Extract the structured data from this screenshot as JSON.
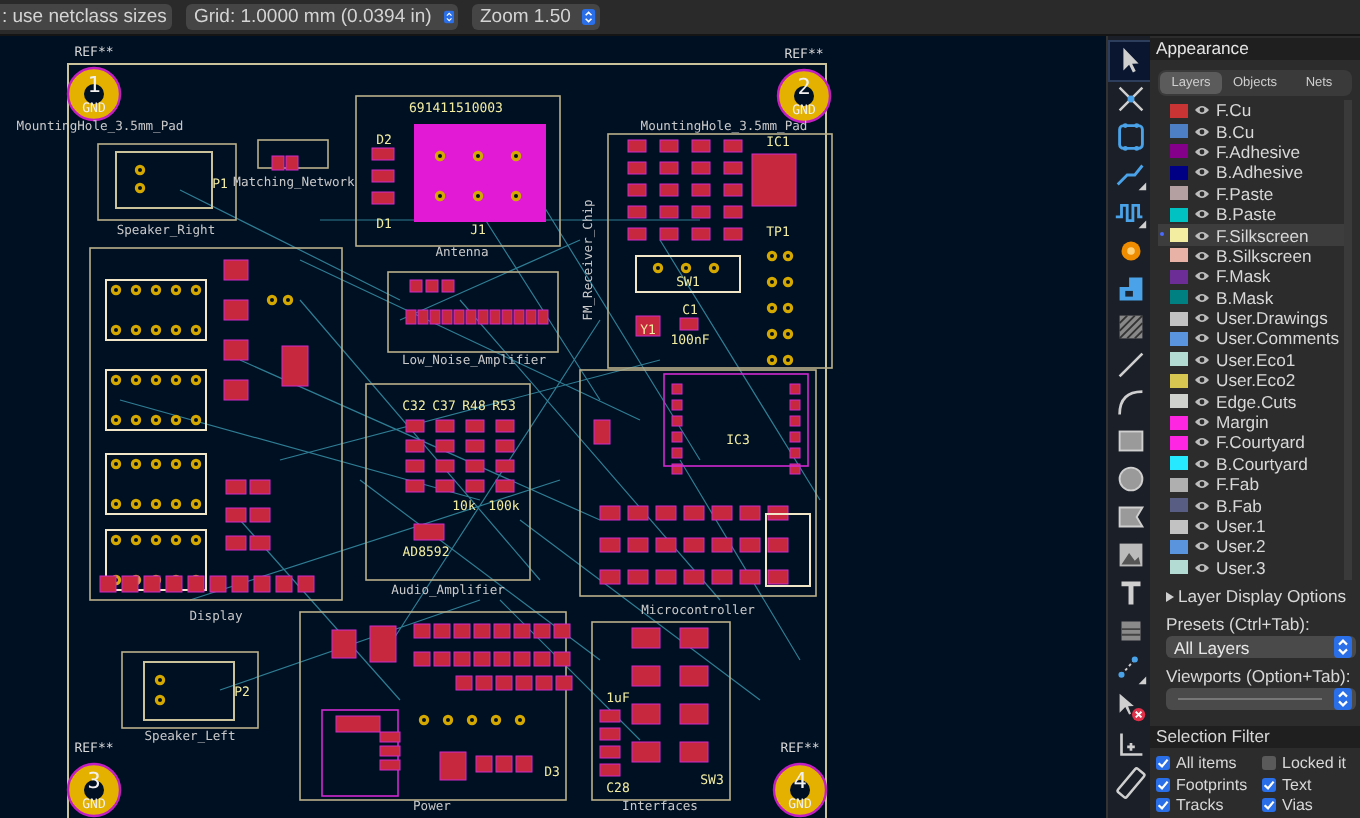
{
  "toolbar": {
    "track_select": ": use netclass sizes",
    "grid_select": "Grid: 1.0000 mm (0.0394 in)",
    "zoom_select": "Zoom 1.50"
  },
  "board": {
    "mounting_holes": [
      {
        "ref": "REF**",
        "number": "1",
        "net": "GND",
        "footprint": "MountingHole_3.5mm_Pad"
      },
      {
        "ref": "REF**",
        "number": "2",
        "net": "GND",
        "footprint": "MountingHole_3.5mm_Pad"
      },
      {
        "ref": "REF**",
        "number": "3",
        "net": "GND"
      },
      {
        "ref": "REF**",
        "number": "4",
        "net": "GND"
      }
    ],
    "groups": [
      {
        "name": "Speaker_Right"
      },
      {
        "name": "Matching_Network"
      },
      {
        "name": "Antenna"
      },
      {
        "name": "Low_Noise_Amplifier"
      },
      {
        "name": "FM_Receiver_Chip"
      },
      {
        "name": "Display"
      },
      {
        "name": "Audio_Amplifier"
      },
      {
        "name": "Microcontroller"
      },
      {
        "name": "Speaker_Left"
      },
      {
        "name": "Power"
      },
      {
        "name": "Interfaces"
      }
    ],
    "component_labels": [
      "691411510003",
      "J1",
      "D2",
      "D1",
      "P1",
      "SW1",
      "IC1",
      "C1",
      "100nF",
      "TP1",
      "IC3",
      "AD8592",
      "10k",
      "100k",
      "C32",
      "C37",
      "R48",
      "R53",
      "P2",
      "SW3",
      "1uF",
      "C28",
      "D3",
      "Y1"
    ]
  },
  "tools": [
    {
      "kind": "select",
      "selected": true
    },
    {
      "kind": "ratsnest",
      "selected": false
    },
    {
      "kind": "footprint",
      "selected": false
    },
    {
      "kind": "route",
      "selected": false
    },
    {
      "kind": "tune",
      "selected": false
    },
    {
      "kind": "via",
      "selected": false
    },
    {
      "kind": "zone",
      "selected": false
    },
    {
      "kind": "rule-area",
      "selected": false
    },
    {
      "kind": "line",
      "selected": false
    },
    {
      "kind": "arc",
      "selected": false
    },
    {
      "kind": "rect",
      "selected": false
    },
    {
      "kind": "circle",
      "selected": false
    },
    {
      "kind": "polygon",
      "selected": false
    },
    {
      "kind": "image",
      "selected": false
    },
    {
      "kind": "text",
      "selected": false
    },
    {
      "kind": "table",
      "selected": false
    },
    {
      "kind": "points",
      "selected": false
    },
    {
      "kind": "delete",
      "selected": false
    },
    {
      "kind": "origin",
      "selected": false
    },
    {
      "kind": "measure",
      "selected": false
    }
  ],
  "appearance": {
    "title": "Appearance",
    "tabs": [
      {
        "label": "Layers",
        "selected": true
      },
      {
        "label": "Objects",
        "selected": false
      },
      {
        "label": "Nets",
        "selected": false
      }
    ],
    "layers": [
      {
        "name": "F.Cu",
        "color": "#c83434",
        "visible": true,
        "selected": false
      },
      {
        "name": "B.Cu",
        "color": "#4d7fc4",
        "visible": true,
        "selected": false
      },
      {
        "name": "F.Adhesive",
        "color": "#84008a",
        "visible": true,
        "selected": false
      },
      {
        "name": "B.Adhesive",
        "color": "#000084",
        "visible": true,
        "selected": false
      },
      {
        "name": "F.Paste",
        "color": "#b4a0a0",
        "visible": true,
        "selected": false
      },
      {
        "name": "B.Paste",
        "color": "#00c2c2",
        "visible": true,
        "selected": false
      },
      {
        "name": "F.Silkscreen",
        "color": "#f2eda1",
        "visible": true,
        "selected": true
      },
      {
        "name": "B.Silkscreen",
        "color": "#e8b2a7",
        "visible": true,
        "selected": false
      },
      {
        "name": "F.Mask",
        "color": "#6c2d96",
        "visible": true,
        "selected": false
      },
      {
        "name": "B.Mask",
        "color": "#008080",
        "visible": true,
        "selected": false
      },
      {
        "name": "User.Drawings",
        "color": "#c2c2c2",
        "visible": true,
        "selected": false
      },
      {
        "name": "User.Comments",
        "color": "#5994dc",
        "visible": true,
        "selected": false
      },
      {
        "name": "User.Eco1",
        "color": "#b4dbd2",
        "visible": true,
        "selected": false
      },
      {
        "name": "User.Eco2",
        "color": "#d8c852",
        "visible": true,
        "selected": false
      },
      {
        "name": "Edge.Cuts",
        "color": "#d0d2cd",
        "visible": true,
        "selected": false
      },
      {
        "name": "Margin",
        "color": "#ff26e2",
        "visible": true,
        "selected": false
      },
      {
        "name": "F.Courtyard",
        "color": "#ff26e3",
        "visible": true,
        "selected": false
      },
      {
        "name": "B.Courtyard",
        "color": "#26e9ff",
        "visible": true,
        "selected": false
      },
      {
        "name": "F.Fab",
        "color": "#afafaf",
        "visible": true,
        "selected": false
      },
      {
        "name": "B.Fab",
        "color": "#585d84",
        "visible": true,
        "selected": false
      },
      {
        "name": "User.1",
        "color": "#c2c2c3",
        "visible": true,
        "selected": false
      },
      {
        "name": "User.2",
        "color": "#5994dd",
        "visible": true,
        "selected": false
      },
      {
        "name": "User.3",
        "color": "#b4dbd3",
        "visible": true,
        "selected": false
      }
    ],
    "layer_display_options": "Layer Display Options",
    "presets": {
      "label": "Presets (Ctrl+Tab):",
      "value": "All Layers"
    },
    "viewports": {
      "label": "Viewports (Option+Tab):"
    },
    "selection_filter": {
      "title": "Selection Filter",
      "items": [
        {
          "label": "All items",
          "checked": true
        },
        {
          "label": "Locked it",
          "checked": false
        },
        {
          "label": "Footprints",
          "checked": true
        },
        {
          "label": "Text",
          "checked": true
        },
        {
          "label": "Tracks",
          "checked": true
        },
        {
          "label": "Vias",
          "checked": true
        }
      ]
    }
  }
}
